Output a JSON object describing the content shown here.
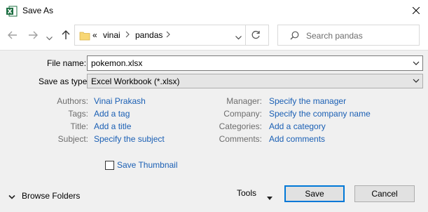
{
  "window": {
    "title": "Save As",
    "app_icon": "excel-icon"
  },
  "nav": {
    "back_icon": "arrow-left-icon",
    "forward_icon": "arrow-right-icon",
    "recent_icon": "chevron-down-icon",
    "up_icon": "arrow-up-icon",
    "breadcrumb": {
      "overflow": "«",
      "items": [
        "vinai",
        "pandas"
      ]
    },
    "search_placeholder": "Search pandas"
  },
  "form": {
    "file_name_label": "File name:",
    "file_name_value": "pokemon.xlsx",
    "save_type_label": "Save as type:",
    "save_type_value": "Excel Workbook (*.xlsx)"
  },
  "metadata": {
    "left": [
      {
        "label": "Authors:",
        "value": "Vinai Prakash"
      },
      {
        "label": "Tags:",
        "value": "Add a tag"
      },
      {
        "label": "Title:",
        "value": "Add a title"
      },
      {
        "label": "Subject:",
        "value": "Specify the subject"
      }
    ],
    "right": [
      {
        "label": "Manager:",
        "value": "Specify the manager"
      },
      {
        "label": "Company:",
        "value": "Specify the company name"
      },
      {
        "label": "Categories:",
        "value": "Add a category"
      },
      {
        "label": "Comments:",
        "value": "Add comments"
      }
    ]
  },
  "options": {
    "save_thumbnail_label": "Save Thumbnail",
    "save_thumbnail_checked": false
  },
  "footer": {
    "browse_folders_label": "Browse Folders",
    "tools_label": "Tools",
    "save_label": "Save",
    "cancel_label": "Cancel"
  },
  "colors": {
    "link": "#1a5fb4",
    "panel_bg": "#f0f0f0",
    "focus_border": "#0078d7",
    "excel_green": "#1d6f42"
  }
}
